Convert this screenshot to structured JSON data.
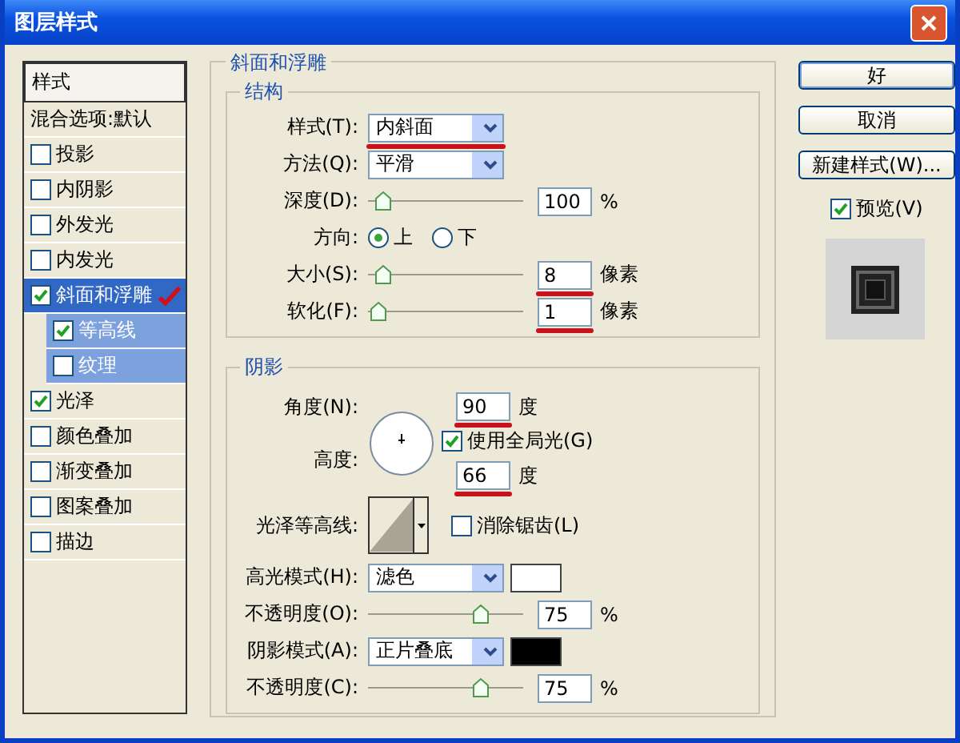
{
  "window": {
    "title": "图层样式"
  },
  "styles_panel": {
    "items": [
      {
        "kind": "header",
        "label": "样式",
        "selected": false
      },
      {
        "kind": "plain",
        "label": "混合选项:默认",
        "selected": false
      },
      {
        "kind": "check",
        "label": "投影",
        "checked": false,
        "selected": false
      },
      {
        "kind": "check",
        "label": "内阴影",
        "checked": false,
        "selected": false
      },
      {
        "kind": "check",
        "label": "外发光",
        "checked": false,
        "selected": false
      },
      {
        "kind": "check",
        "label": "内发光",
        "checked": false,
        "selected": false
      },
      {
        "kind": "check",
        "label": "斜面和浮雕",
        "checked": true,
        "selected": true,
        "marked": true
      },
      {
        "kind": "sub",
        "label": "等高线",
        "checked": true,
        "selected": false
      },
      {
        "kind": "sub",
        "label": "纹理",
        "checked": false,
        "selected": false
      },
      {
        "kind": "check",
        "label": "光泽",
        "checked": true,
        "selected": false
      },
      {
        "kind": "check",
        "label": "颜色叠加",
        "checked": false,
        "selected": false
      },
      {
        "kind": "check",
        "label": "渐变叠加",
        "checked": false,
        "selected": false
      },
      {
        "kind": "check",
        "label": "图案叠加",
        "checked": false,
        "selected": false
      },
      {
        "kind": "check",
        "label": "描边",
        "checked": false,
        "selected": false
      }
    ]
  },
  "bevel": {
    "title": "斜面和浮雕",
    "structure": {
      "title": "结构",
      "rows": [
        {
          "kind": "select",
          "label": "样式(T):",
          "value": "内斜面",
          "marked": true
        },
        {
          "kind": "select",
          "label": "方法(Q):",
          "value": "平滑"
        },
        {
          "kind": "slider",
          "label": "深度(D):",
          "level": 0.03,
          "value": "100",
          "unit": "%"
        },
        {
          "kind": "radio",
          "label": "方向:",
          "options": [
            {
              "label": "上",
              "selected": true
            },
            {
              "label": "下",
              "selected": false
            }
          ]
        },
        {
          "kind": "slider",
          "label": "大小(S):",
          "level": 0.03,
          "value": "8",
          "unit": "像素",
          "marked": true
        },
        {
          "kind": "slider",
          "label": "软化(F):",
          "level": 0.0,
          "value": "1",
          "unit": "像素",
          "marked": true
        }
      ]
    },
    "shading": {
      "title": "阴影",
      "angle": {
        "label": "角度(N):",
        "value": "90",
        "unit": "度",
        "marked": true
      },
      "global_light": {
        "label": "使用全局光(G)",
        "checked": true
      },
      "altitude": {
        "label": "高度:",
        "value": "66",
        "unit": "度",
        "marked": true
      },
      "gloss_contour": {
        "label": "光泽等高线:"
      },
      "anti_aliased": {
        "label": "消除锯齿(L)",
        "checked": false
      },
      "rows": [
        {
          "kind": "blend",
          "label": "高光模式(H):",
          "value": "滤色",
          "color": "#ffffff"
        },
        {
          "kind": "slider",
          "label": "不透明度(O):",
          "level": 0.75,
          "value": "75",
          "unit": "%"
        },
        {
          "kind": "blend",
          "label": "阴影模式(A):",
          "value": "正片叠底",
          "color": "#000000"
        },
        {
          "kind": "slider",
          "label": "不透明度(C):",
          "level": 0.75,
          "value": "75",
          "unit": "%"
        }
      ]
    }
  },
  "buttons": [
    {
      "label": "好",
      "default": true
    },
    {
      "label": "取消",
      "default": false
    },
    {
      "label": "新建样式(W)...",
      "default": false
    }
  ],
  "preview": {
    "label": "预览(V)",
    "checked": true
  }
}
